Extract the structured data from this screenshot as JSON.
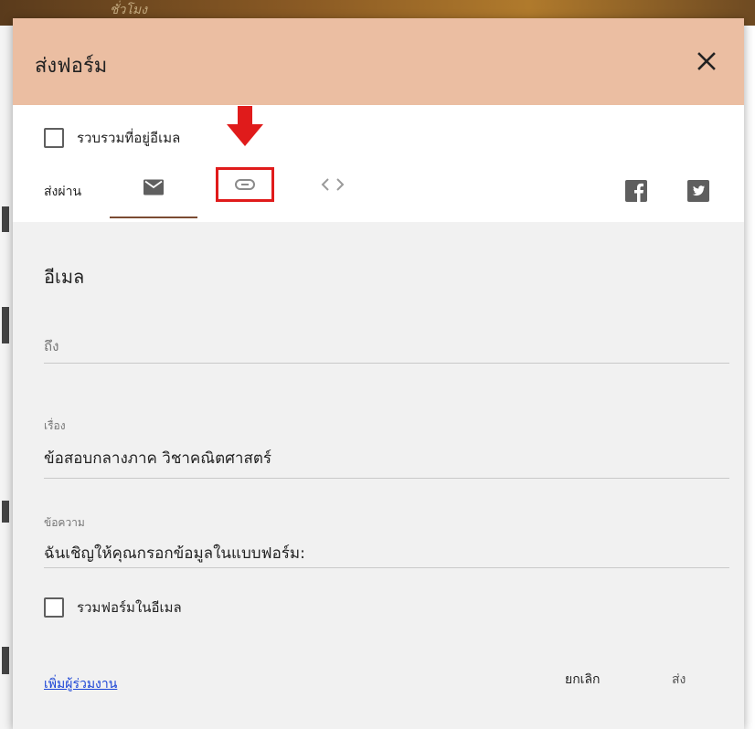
{
  "background": {
    "banner_text": "ชั่วโมง",
    "side_glyph": "ใ"
  },
  "dialog": {
    "title": "ส่งฟอร์ม",
    "collect_emails_label": "รวบรวมที่อยู่อีเมล",
    "send_via_label": "ส่งผ่าน",
    "tabs": [
      {
        "name": "email",
        "icon": "mail-icon",
        "selected": true
      },
      {
        "name": "link",
        "icon": "link-icon",
        "selected": false
      },
      {
        "name": "embed",
        "icon": "embed-code-icon",
        "selected": false
      }
    ],
    "share_icons": [
      "facebook-icon",
      "twitter-icon"
    ],
    "section_title": "อีเมล",
    "to": {
      "placeholder": "ถึง",
      "value": ""
    },
    "subject": {
      "label": "เรื่อง",
      "value": "ข้อสอบกลางภาค วิชาคณิตศาสตร์"
    },
    "message": {
      "label": "ข้อความ",
      "value": "ฉันเชิญให้คุณกรอกข้อมูลในแบบฟอร์ม:"
    },
    "include_form_label": "รวมฟอร์มในอีเมล",
    "add_collaborators": "เพิ่มผู้ร่วมงาน",
    "cancel": "ยกเลิก",
    "send": "ส่ง"
  },
  "colors": {
    "header": "#ebbea2",
    "tab_underline": "#7b4b32",
    "highlight": "#e01b1b",
    "link": "#1a44d6"
  }
}
